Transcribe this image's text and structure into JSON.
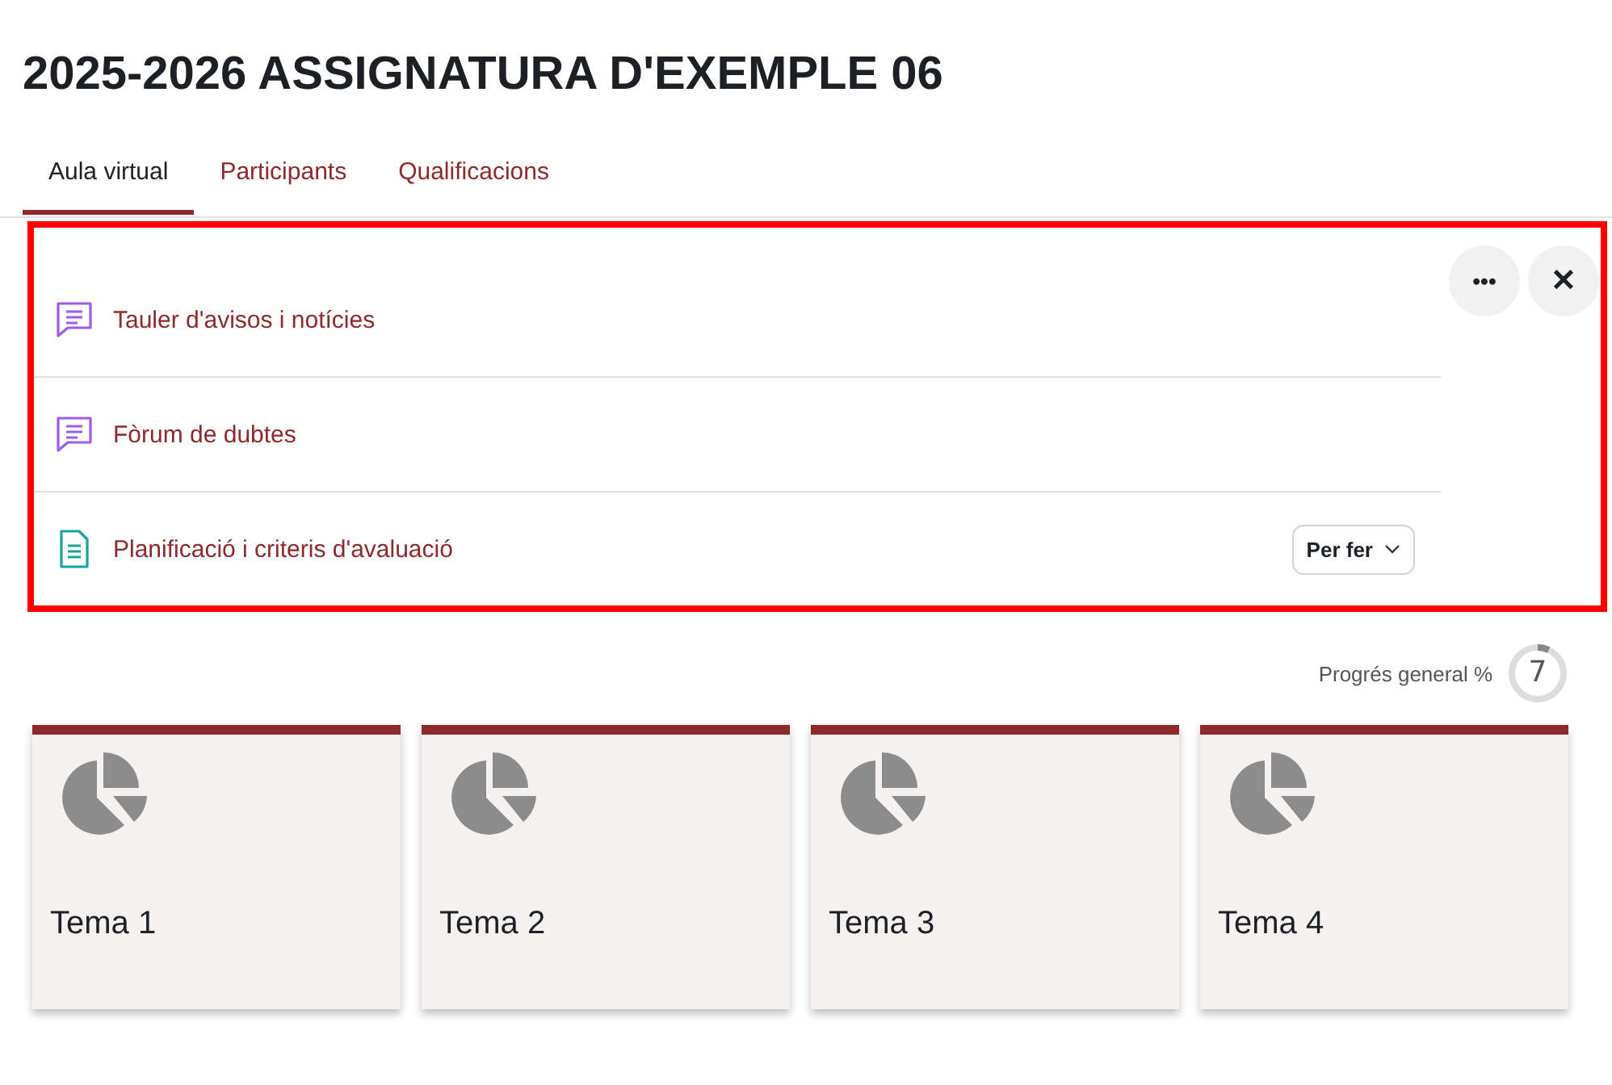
{
  "page_title": "2025-2026 ASSIGNATURA D'EXEMPLE 06",
  "tabs": [
    {
      "label": "Aula virtual",
      "selected": true
    },
    {
      "label": "Participants",
      "selected": false
    },
    {
      "label": "Qualificacions",
      "selected": false
    }
  ],
  "activities": [
    {
      "kind": "forum",
      "name": "Tauler d'avisos i notícies"
    },
    {
      "kind": "forum",
      "name": "Fòrum de dubtes"
    },
    {
      "kind": "page",
      "name": "Planificació i criteris d'avaluació",
      "status": "Per fer"
    }
  ],
  "actions": {
    "more": "•••",
    "close": "✕"
  },
  "progress": {
    "label": "Progrés general %",
    "value": "7",
    "level": 0.07
  },
  "sections": [
    {
      "title": "Tema 1"
    },
    {
      "title": "Tema 2"
    },
    {
      "title": "Tema 3"
    },
    {
      "title": "Tema 4"
    }
  ]
}
